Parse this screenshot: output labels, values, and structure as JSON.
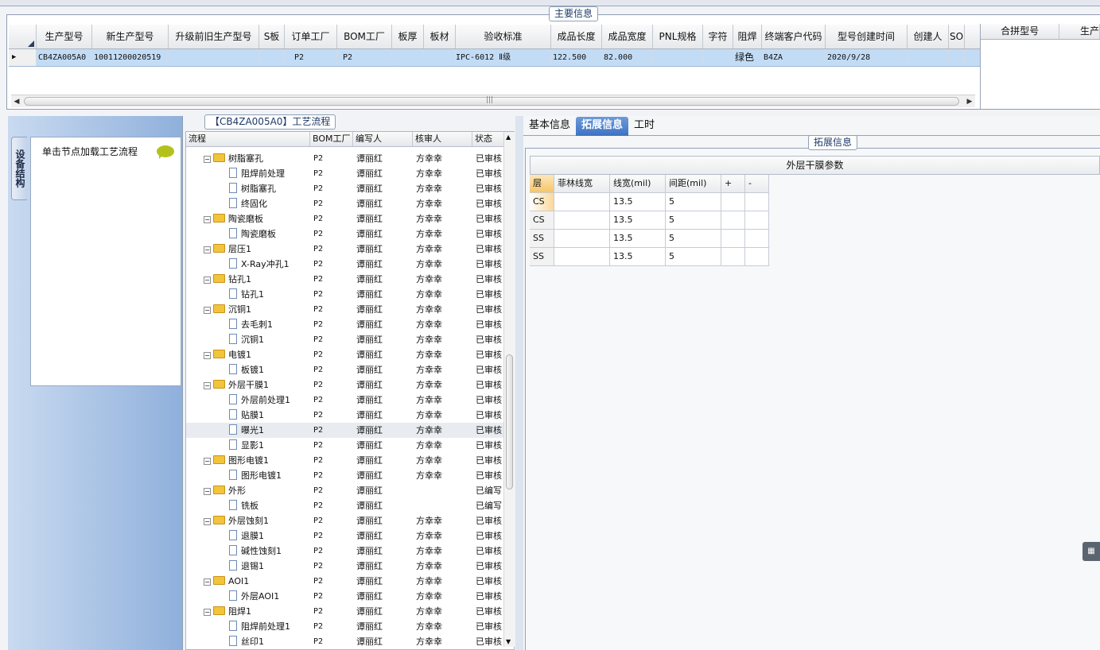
{
  "main_info": {
    "title": "主要信息",
    "columns": [
      "生产型号",
      "新生产型号",
      "升级前旧生产型号",
      "S板",
      "订单工厂",
      "BOM工厂",
      "板厚",
      "板材",
      "验收标准",
      "成品长度",
      "成品宽度",
      "PNL规格",
      "字符",
      "阻焊",
      "终端客户代码",
      "型号创建时间",
      "创建人",
      "SO"
    ],
    "row": {
      "prod_no": "CB4ZA005A0",
      "new_prod_no": "10011200020519",
      "old_prod_no": "",
      "s_board": "",
      "order_factory": "P2",
      "bom_factory": "P2",
      "thickness": "",
      "material": "",
      "standard": "IPC-6012 Ⅱ级",
      "length": "122.500",
      "width": "82.000",
      "pnl": "",
      "char": "",
      "solder_mask": "绿色",
      "customer_code": "B4ZA",
      "created": "2020/9/28",
      "creator": "",
      "so": ""
    },
    "right_columns": [
      "合拼型号",
      "生产"
    ]
  },
  "side": {
    "vertical_tab": "设备结构",
    "node_hint": "单击节点加载工艺流程"
  },
  "process": {
    "title": "【CB4ZA005A0】工艺流程",
    "columns": [
      "流程",
      "BOM工厂",
      "编写人",
      "核审人",
      "状态"
    ],
    "rows": [
      {
        "indent": 1,
        "type": "folder",
        "name": "树脂塞孔",
        "bom": "P2",
        "writer": "谭丽红",
        "reviewer": "方幸幸",
        "status": "已审核"
      },
      {
        "indent": 2,
        "type": "doc",
        "name": "阻焊前处理",
        "bom": "P2",
        "writer": "谭丽红",
        "reviewer": "方幸幸",
        "status": "已审核"
      },
      {
        "indent": 2,
        "type": "doc",
        "name": "树脂塞孔",
        "bom": "P2",
        "writer": "谭丽红",
        "reviewer": "方幸幸",
        "status": "已审核"
      },
      {
        "indent": 2,
        "type": "doc",
        "name": "终固化",
        "bom": "P2",
        "writer": "谭丽红",
        "reviewer": "方幸幸",
        "status": "已审核"
      },
      {
        "indent": 1,
        "type": "folder",
        "name": "陶瓷磨板",
        "bom": "P2",
        "writer": "谭丽红",
        "reviewer": "方幸幸",
        "status": "已审核"
      },
      {
        "indent": 2,
        "type": "doc",
        "name": "陶瓷磨板",
        "bom": "P2",
        "writer": "谭丽红",
        "reviewer": "方幸幸",
        "status": "已审核"
      },
      {
        "indent": 1,
        "type": "folder",
        "name": "层压1",
        "bom": "P2",
        "writer": "谭丽红",
        "reviewer": "方幸幸",
        "status": "已审核"
      },
      {
        "indent": 2,
        "type": "doc",
        "name": "X-Ray冲孔1",
        "bom": "P2",
        "writer": "谭丽红",
        "reviewer": "方幸幸",
        "status": "已审核"
      },
      {
        "indent": 1,
        "type": "folder",
        "name": "钻孔1",
        "bom": "P2",
        "writer": "谭丽红",
        "reviewer": "方幸幸",
        "status": "已审核"
      },
      {
        "indent": 2,
        "type": "doc",
        "name": "钻孔1",
        "bom": "P2",
        "writer": "谭丽红",
        "reviewer": "方幸幸",
        "status": "已审核"
      },
      {
        "indent": 1,
        "type": "folder",
        "name": "沉铜1",
        "bom": "P2",
        "writer": "谭丽红",
        "reviewer": "方幸幸",
        "status": "已审核"
      },
      {
        "indent": 2,
        "type": "doc",
        "name": "去毛刺1",
        "bom": "P2",
        "writer": "谭丽红",
        "reviewer": "方幸幸",
        "status": "已审核"
      },
      {
        "indent": 2,
        "type": "doc",
        "name": "沉铜1",
        "bom": "P2",
        "writer": "谭丽红",
        "reviewer": "方幸幸",
        "status": "已审核"
      },
      {
        "indent": 1,
        "type": "folder",
        "name": "电镀1",
        "bom": "P2",
        "writer": "谭丽红",
        "reviewer": "方幸幸",
        "status": "已审核"
      },
      {
        "indent": 2,
        "type": "doc",
        "name": "板镀1",
        "bom": "P2",
        "writer": "谭丽红",
        "reviewer": "方幸幸",
        "status": "已审核"
      },
      {
        "indent": 1,
        "type": "folder",
        "name": "外层干膜1",
        "bom": "P2",
        "writer": "谭丽红",
        "reviewer": "方幸幸",
        "status": "已审核"
      },
      {
        "indent": 2,
        "type": "doc",
        "name": "外层前处理1",
        "bom": "P2",
        "writer": "谭丽红",
        "reviewer": "方幸幸",
        "status": "已审核"
      },
      {
        "indent": 2,
        "type": "doc",
        "name": "贴膜1",
        "bom": "P2",
        "writer": "谭丽红",
        "reviewer": "方幸幸",
        "status": "已审核"
      },
      {
        "indent": 2,
        "type": "doc",
        "name": "曝光1",
        "bom": "P2",
        "writer": "谭丽红",
        "reviewer": "方幸幸",
        "status": "已审核",
        "selected": true
      },
      {
        "indent": 2,
        "type": "doc",
        "name": "显影1",
        "bom": "P2",
        "writer": "谭丽红",
        "reviewer": "方幸幸",
        "status": "已审核"
      },
      {
        "indent": 1,
        "type": "folder",
        "name": "图形电镀1",
        "bom": "P2",
        "writer": "谭丽红",
        "reviewer": "方幸幸",
        "status": "已审核"
      },
      {
        "indent": 2,
        "type": "doc",
        "name": "图形电镀1",
        "bom": "P2",
        "writer": "谭丽红",
        "reviewer": "方幸幸",
        "status": "已审核"
      },
      {
        "indent": 1,
        "type": "folder",
        "name": "外形",
        "bom": "P2",
        "writer": "谭丽红",
        "reviewer": "",
        "status": "已编写"
      },
      {
        "indent": 2,
        "type": "doc",
        "name": "铣板",
        "bom": "P2",
        "writer": "谭丽红",
        "reviewer": "",
        "status": "已编写"
      },
      {
        "indent": 1,
        "type": "folder",
        "name": "外层蚀刻1",
        "bom": "P2",
        "writer": "谭丽红",
        "reviewer": "方幸幸",
        "status": "已审核"
      },
      {
        "indent": 2,
        "type": "doc",
        "name": "退膜1",
        "bom": "P2",
        "writer": "谭丽红",
        "reviewer": "方幸幸",
        "status": "已审核"
      },
      {
        "indent": 2,
        "type": "doc",
        "name": "碱性蚀刻1",
        "bom": "P2",
        "writer": "谭丽红",
        "reviewer": "方幸幸",
        "status": "已审核"
      },
      {
        "indent": 2,
        "type": "doc",
        "name": "退锡1",
        "bom": "P2",
        "writer": "谭丽红",
        "reviewer": "方幸幸",
        "status": "已审核"
      },
      {
        "indent": 1,
        "type": "folder",
        "name": "AOI1",
        "bom": "P2",
        "writer": "谭丽红",
        "reviewer": "方幸幸",
        "status": "已审核"
      },
      {
        "indent": 2,
        "type": "doc",
        "name": "外层AOI1",
        "bom": "P2",
        "writer": "谭丽红",
        "reviewer": "方幸幸",
        "status": "已审核"
      },
      {
        "indent": 1,
        "type": "folder",
        "name": "阻焊1",
        "bom": "P2",
        "writer": "谭丽红",
        "reviewer": "方幸幸",
        "status": "已审核"
      },
      {
        "indent": 2,
        "type": "doc",
        "name": "阻焊前处理1",
        "bom": "P2",
        "writer": "谭丽红",
        "reviewer": "方幸幸",
        "status": "已审核"
      },
      {
        "indent": 2,
        "type": "doc",
        "name": "丝印1",
        "bom": "P2",
        "writer": "谭丽红",
        "reviewer": "方幸幸",
        "status": "已审核"
      }
    ]
  },
  "tabs": {
    "basic": "基本信息",
    "extended": "拓展信息",
    "hours": "工时"
  },
  "extended": {
    "title": "拓展信息",
    "table_title": "外层干膜参数",
    "columns": [
      "层",
      "菲林线宽",
      "线宽(mil)",
      "间距(mil)",
      "+",
      "-"
    ],
    "rows": [
      {
        "layer": "CS",
        "film": "",
        "width": "13.5",
        "spacing": "5"
      },
      {
        "layer": "CS",
        "film": "",
        "width": "13.5",
        "spacing": "5"
      },
      {
        "layer": "SS",
        "film": "",
        "width": "13.5",
        "spacing": "5"
      },
      {
        "layer": "SS",
        "film": "",
        "width": "13.5",
        "spacing": "5"
      }
    ]
  }
}
